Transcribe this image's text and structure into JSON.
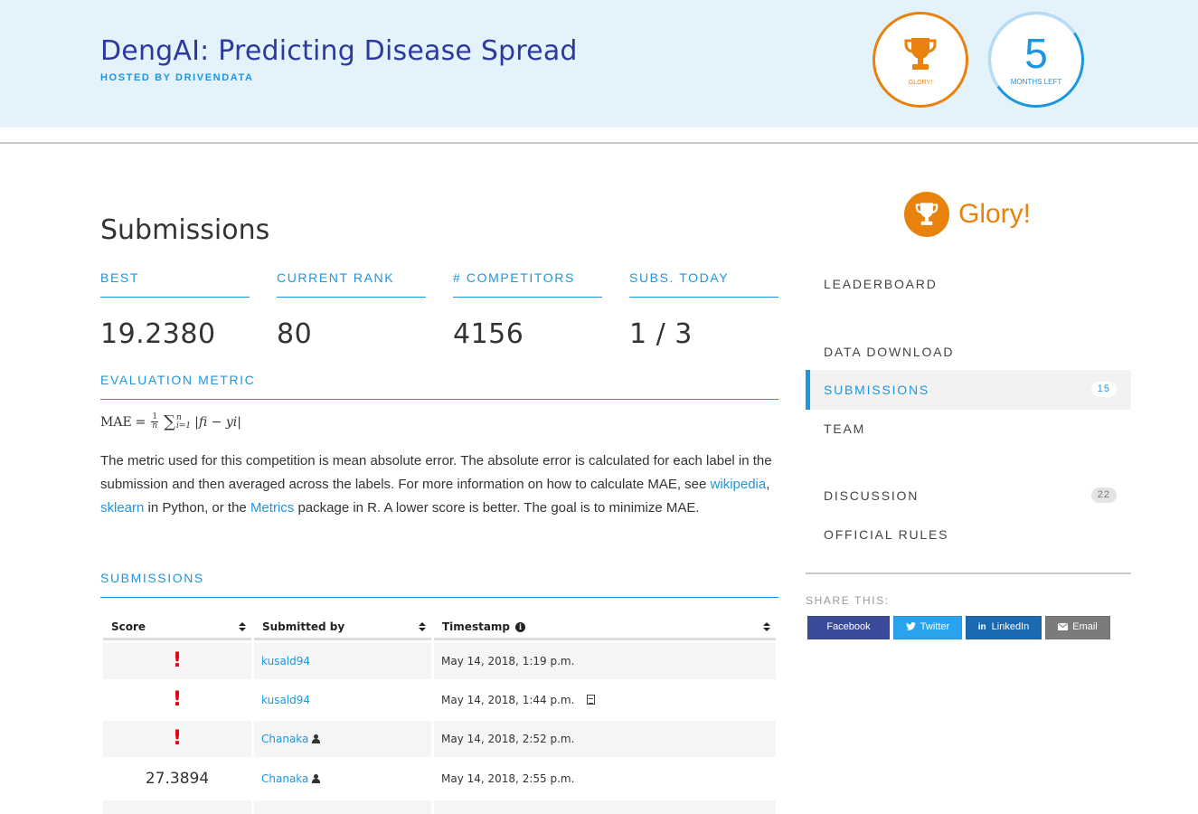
{
  "header": {
    "title": "DengAI: Predicting Disease Spread",
    "host": "HOSTED BY DRIVENDATA",
    "badge_glory": "GLORY!",
    "months_value": "5",
    "months_label": "MONTHS LEFT",
    "colors": {
      "accent": "#1c96e0",
      "glory": "#e8820c",
      "title": "#2b3a9c",
      "hero_bg": "#e3f2fb"
    }
  },
  "main": {
    "page_title": "Submissions",
    "stats": [
      {
        "label": "BEST",
        "value": "19.2380"
      },
      {
        "label": "CURRENT RANK",
        "value": "80"
      },
      {
        "label": "# COMPETITORS",
        "value": "4156"
      },
      {
        "label": "SUBS. TODAY",
        "value": "1 / 3"
      }
    ],
    "metric_heading": "EVALUATION METRIC",
    "formula": {
      "lhs": "MAE",
      "eq": "=",
      "num": "1",
      "den": "n",
      "sum": "∑",
      "sum_upper": "n",
      "sum_lower": "i=1",
      "body": "|fi − yi|"
    },
    "description": {
      "part1": "The metric used for this competition is mean absolute error. The absolute error is calculated for each label in the submission and then averaged across the labels. For more information on how to calculate MAE, see ",
      "link_wikipedia": "wikipedia",
      "comma": ", ",
      "link_sklearn": "sklearn",
      "part2": " in Python, or the ",
      "link_metrics": "Metrics",
      "part3": " package in R. A lower score is better. The goal is to minimize MAE."
    },
    "submissions_heading": "SUBMISSIONS",
    "table": {
      "headers": {
        "score": "Score",
        "submitted_by": "Submitted by",
        "timestamp": "Timestamp"
      },
      "info_icon": "i",
      "error_icon": "!",
      "rows": [
        {
          "score": "!",
          "error": true,
          "by": "kusald94",
          "team": false,
          "ts": "May 14, 2018, 1:19 p.m.",
          "doc": false
        },
        {
          "score": "!",
          "error": true,
          "by": "kusald94",
          "team": false,
          "ts": "May 14, 2018, 1:44 p.m.",
          "doc": true
        },
        {
          "score": "!",
          "error": true,
          "by": "Chanaka",
          "team": true,
          "ts": "May 14, 2018, 2:52 p.m.",
          "doc": false
        },
        {
          "score": "27.3894",
          "error": false,
          "by": "Chanaka",
          "team": true,
          "ts": "May 14, 2018, 2:55 p.m.",
          "doc": false
        }
      ]
    }
  },
  "sidebar": {
    "glory_label": "Glory!",
    "nav": [
      {
        "label": "LEADERBOARD",
        "count": ""
      },
      {
        "label": "DATA DOWNLOAD",
        "count": ""
      },
      {
        "label": "SUBMISSIONS",
        "count": "15",
        "active": true
      },
      {
        "label": "TEAM",
        "count": ""
      },
      {
        "label": "DISCUSSION",
        "count": "22"
      },
      {
        "label": "OFFICIAL RULES",
        "count": ""
      }
    ],
    "share_label": "SHARE THIS:",
    "share": [
      {
        "label": "Facebook",
        "icon": "",
        "color": "#3b4a9a"
      },
      {
        "label": "Twitter",
        "icon": "twitter-bird-icon",
        "color": "#2aa3ef"
      },
      {
        "label": "LinkedIn",
        "icon": "in",
        "color": "#1b6ab0"
      },
      {
        "label": "Email",
        "icon": "envelope-icon",
        "color": "#7b7b7b"
      }
    ]
  }
}
